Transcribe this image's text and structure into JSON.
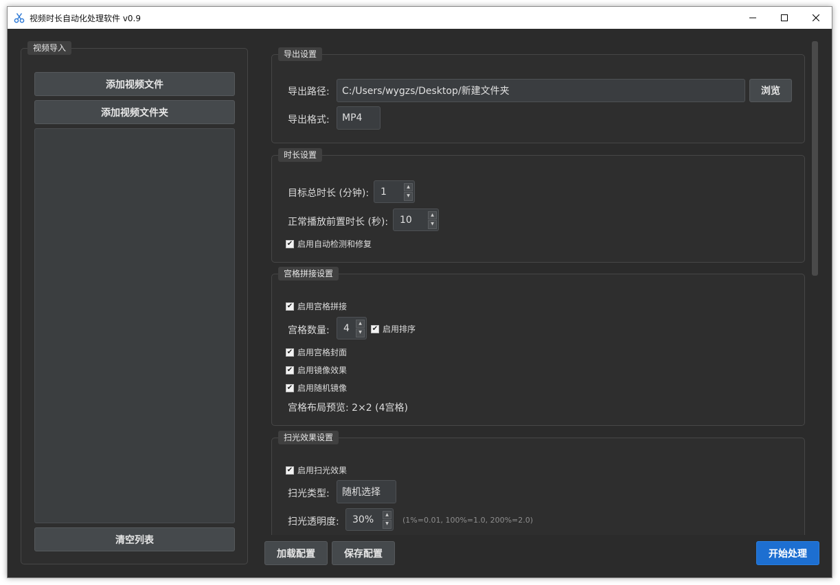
{
  "window": {
    "title": "视频时长自动化处理软件 v0.9"
  },
  "import_panel": {
    "title": "视频导入",
    "add_file": "添加视频文件",
    "add_folder": "添加视频文件夹",
    "clear": "清空列表"
  },
  "export": {
    "title": "导出设置",
    "path_label": "导出路径:",
    "path_value": "C:/Users/wygzs/Desktop/新建文件夹",
    "browse": "浏览",
    "format_label": "导出格式:",
    "format_value": "MP4"
  },
  "duration": {
    "title": "时长设置",
    "target_label": "目标总时长 (分钟):",
    "target_value": "1",
    "pre_label": "正常播放前置时长 (秒):",
    "pre_value": "10",
    "auto_fix": "启用自动检测和修复",
    "auto_fix_checked": true
  },
  "grid": {
    "title": "宫格拼接设置",
    "enable": "启用宫格拼接",
    "count_label": "宫格数量:",
    "count_value": "4",
    "sort": "启用排序",
    "cover": "启用宫格封面",
    "mirror": "启用镜像效果",
    "random_mirror": "启用随机镜像",
    "preview": "宫格布局预览: 2×2 (4宫格)"
  },
  "sweep": {
    "title": "扫光效果设置",
    "enable": "启用扫光效果",
    "type_label": "扫光类型:",
    "type_value": "随机选择",
    "opacity_label": "扫光透明度:",
    "opacity_value": "30%",
    "opacity_hint": "(1%=0.01, 100%=1.0, 200%=2.0)"
  },
  "footer": {
    "load": "加载配置",
    "save": "保存配置",
    "start": "开始处理"
  },
  "colors": {
    "background": "#2b2b2b",
    "panel": "#2e2e2e",
    "button": "#45494c",
    "accent": "#1d6fd1"
  }
}
